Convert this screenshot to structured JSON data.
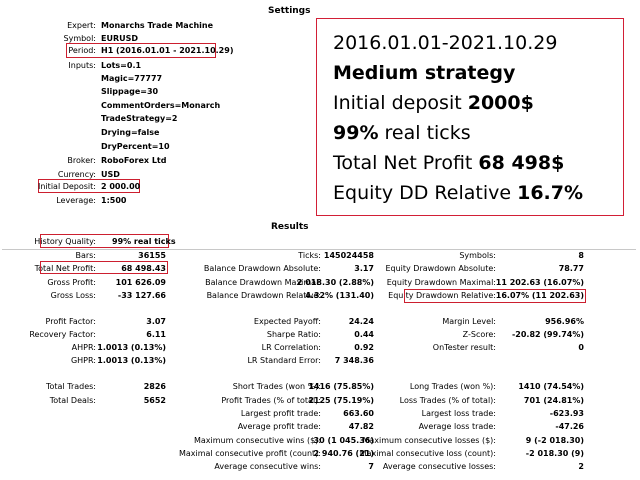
{
  "settings": {
    "title": "Settings",
    "expert_label": "Expert:",
    "expert": "Monarchs Trade Machine",
    "symbol_label": "Symbol:",
    "symbol": "EURUSD",
    "period_label": "Period:",
    "period": "H1 (2016.01.01 - 2021.10.29)",
    "inputs_label": "Inputs:",
    "inputs": [
      "Lots=0.1",
      "Magic=77777",
      "Slippage=30",
      "CommentOrders=Monarch",
      "TradeStrategy=2",
      "Drying=false",
      "DryPercent=10"
    ],
    "broker_label": "Broker:",
    "broker": "RoboForex Ltd",
    "currency_label": "Currency:",
    "currency": "USD",
    "deposit_label": "Initial Deposit:",
    "deposit": "2 000.00",
    "leverage_label": "Leverage:",
    "leverage": "1:500"
  },
  "overlay": {
    "period": "2016.01.01-2021.10.29",
    "strategy": "Medium strategy",
    "deposit_prefix": "Initial deposit ",
    "deposit_value": "2000$",
    "ticks_value": "99%",
    "ticks_suffix": " real ticks",
    "profit_prefix": "Total Net Profit ",
    "profit_value": "68 498$",
    "dd_prefix": "Equity DD Relative ",
    "dd_value": "16.7%"
  },
  "results": {
    "title": "Results",
    "history_quality_label": "History Quality:",
    "history_quality": "99% real ticks",
    "col1": [
      {
        "label": "Bars:",
        "value": "36155"
      },
      {
        "label": "Total Net Profit:",
        "value": "68 498.43"
      },
      {
        "label": "Gross Profit:",
        "value": "101 626.09"
      },
      {
        "label": "Gross Loss:",
        "value": "-33 127.66"
      },
      {
        "label": "Profit Factor:",
        "value": "3.07"
      },
      {
        "label": "Recovery Factor:",
        "value": "6.11"
      },
      {
        "label": "AHPR:",
        "value": "1.0013 (0.13%)"
      },
      {
        "label": "GHPR:",
        "value": "1.0013 (0.13%)"
      },
      {
        "label": "Total Trades:",
        "value": "2826"
      },
      {
        "label": "Total Deals:",
        "value": "5652"
      }
    ],
    "col2": [
      {
        "label": "Ticks:",
        "value": "145024458"
      },
      {
        "label": "Balance Drawdown Absolute:",
        "value": "3.17"
      },
      {
        "label": "Balance Drawdown Maximal:",
        "value": "2 018.30 (2.88%)"
      },
      {
        "label": "Balance Drawdown Relative:",
        "value": "4.32% (131.40)"
      },
      {
        "label": "Expected Payoff:",
        "value": "24.24"
      },
      {
        "label": "Sharpe Ratio:",
        "value": "0.44"
      },
      {
        "label": "LR Correlation:",
        "value": "0.92"
      },
      {
        "label": "LR Standard Error:",
        "value": "7 348.36"
      },
      {
        "label": "Short Trades (won %):",
        "value": "1416 (75.85%)"
      },
      {
        "label": "Profit Trades (% of total):",
        "value": "2125 (75.19%)"
      },
      {
        "label": "Largest profit trade:",
        "value": "663.60"
      },
      {
        "label": "Average profit trade:",
        "value": "47.82"
      },
      {
        "label": "Maximum consecutive wins ($):",
        "value": "30 (1 045.36)"
      },
      {
        "label": "Maximal consecutive profit (count):",
        "value": "2 940.76 (21)"
      },
      {
        "label": "Average consecutive wins:",
        "value": "7"
      }
    ],
    "col3": [
      {
        "label": "Symbols:",
        "value": "8"
      },
      {
        "label": "Equity Drawdown Absolute:",
        "value": "78.77"
      },
      {
        "label": "Equity Drawdown Maximal:",
        "value": "11 202.63 (16.07%)"
      },
      {
        "label": "Equity Drawdown Relative:",
        "value": "16.07% (11 202.63)"
      },
      {
        "label": "Margin Level:",
        "value": "956.96%"
      },
      {
        "label": "Z-Score:",
        "value": "-20.82 (99.74%)"
      },
      {
        "label": "OnTester result:",
        "value": "0"
      },
      {
        "label": "Long Trades (won %):",
        "value": "1410 (74.54%)"
      },
      {
        "label": "Loss Trades (% of total):",
        "value": "701 (24.81%)"
      },
      {
        "label": "Largest loss trade:",
        "value": "-623.93"
      },
      {
        "label": "Average loss trade:",
        "value": "-47.26"
      },
      {
        "label": "Maximum consecutive losses ($):",
        "value": "9 (-2 018.30)"
      },
      {
        "label": "Maximal consecutive loss (count):",
        "value": "-2 018.30 (9)"
      },
      {
        "label": "Average consecutive losses:",
        "value": "2"
      }
    ]
  }
}
